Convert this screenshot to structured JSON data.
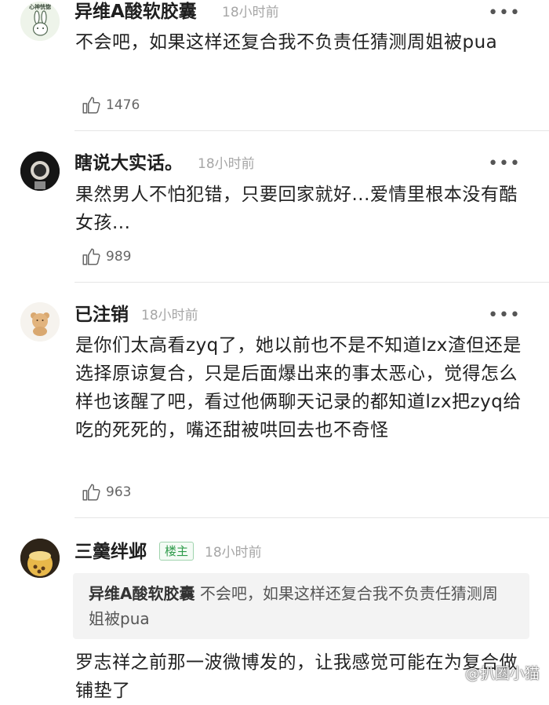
{
  "comments": [
    {
      "username": "异维A酸软胶囊",
      "time": "18小时前",
      "more": "•••",
      "content": "不会吧，如果这样还复合我不负责任猜测周姐被pua",
      "likes": "1476",
      "avatar_text": "心神恍惚"
    },
    {
      "username": "瞎说大实话。",
      "time": "18小时前",
      "more": "•••",
      "content": "果然男人不怕犯错，只要回家就好...爱情里根本没有酷女孩...",
      "likes": "989"
    },
    {
      "username": "已注销",
      "time": "18小时前",
      "more": "•••",
      "content": "是你们太高看zyq了，她以前也不是不知道lzx渣但还是选择原谅复合，只是后面爆出来的事太恶心，觉得怎么样也该醒了吧，看过他俩聊天记录的都知道lzx把zyq给吃的死死的，嘴还甜被哄回去也不奇怪",
      "likes": "963"
    },
    {
      "username": "三羹绊邺",
      "badge": "楼主",
      "time": "18小时前",
      "more": "•••",
      "quote_user": "异维A酸软胶囊",
      "quote_text": "不会吧，如果这样还复合我不负责任猜测周姐被pua",
      "content": "罗志祥之前那一波微博发的，让我感觉可能在为复合做铺垫了"
    }
  ],
  "watermark": "@扒圈小猫",
  "colors": {
    "badge_green": "#2e9b4a",
    "time_gray": "#a6a6a6"
  }
}
